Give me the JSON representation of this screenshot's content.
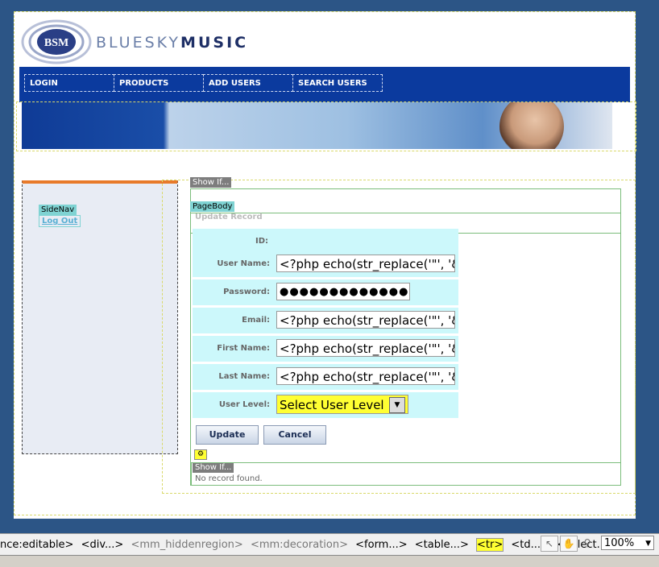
{
  "brand": {
    "prefix": "BLUESKY",
    "suffix": "MUSIC",
    "logo_text": "BSM"
  },
  "nav": [
    {
      "label": "LOGIN"
    },
    {
      "label": "PRODUCTS"
    },
    {
      "label": "ADD USERS"
    },
    {
      "label": "SEARCH USERS"
    }
  ],
  "sidebar": {
    "tag": "SideNav",
    "link": "Log Out"
  },
  "tags": {
    "show_if": "Show If...",
    "page_body": "PageBody",
    "update_record": "Update Record"
  },
  "form": {
    "rows": [
      {
        "label": "ID:",
        "value": ""
      },
      {
        "label": "User Name:",
        "value": "<?php echo(str_replace('\"', '&quot;', $row_rsUser['username'])); ?>"
      },
      {
        "label": "Password:",
        "value": "●●●●●●●●●●●●●●●●"
      },
      {
        "label": "Email:",
        "value": "<?php echo(str_replace('\"', '&quot;', $row_rsUser['email'])); ?>"
      },
      {
        "label": "First Name:",
        "value": "<?php echo(str_replace('\"', '&quot;', $row_rsUser['firstname'])); ?>"
      },
      {
        "label": "Last Name:",
        "value": "<?php echo(str_replace('\"', '&quot;', $row_rsUser['lastname'])); ?>"
      }
    ],
    "level_label": "User Level:",
    "level_value": "Select User Level",
    "update": "Update",
    "cancel": "Cancel"
  },
  "show_if_2": "Show If...",
  "no_record": "No record found.",
  "statusbar": {
    "crumbs": [
      "nce:editable>",
      "<div...>",
      "<mm_hiddenregion>",
      "<mm:decoration>",
      "<form...>",
      "<table...>",
      "<tr>",
      "<td...>",
      "<select...>"
    ],
    "zoom": "100%"
  },
  "colors": {
    "navbar": "#0b3a9e",
    "bg": "#2c5586",
    "row": "#ccf8fb",
    "highlight": "#ffff33"
  }
}
